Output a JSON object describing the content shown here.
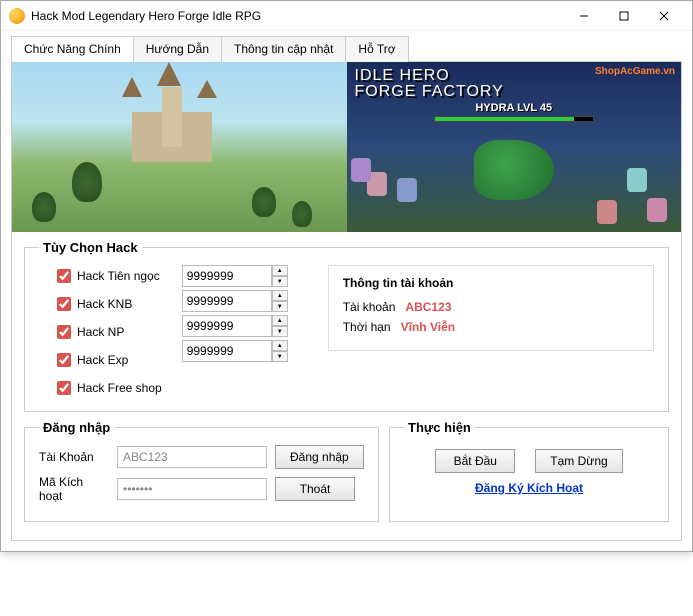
{
  "window": {
    "title": "Hack Mod Legendary Hero Forge Idle RPG"
  },
  "tabs": [
    {
      "label": "Chức Năng Chính"
    },
    {
      "label": "Hướng Dẫn"
    },
    {
      "label": "Thông tin cập nhật"
    },
    {
      "label": "Hỗ Trợ"
    }
  ],
  "banner": {
    "game_title_1": "IDLE HERO",
    "game_title_2": "FORGE FACTORY",
    "boss_label": "HYDRA LVL 45",
    "watermark": "ShopAcGame.vn"
  },
  "hack": {
    "legend": "Tùy Chọn Hack",
    "options": [
      {
        "label": "Hack Tiên ngọc",
        "value": "9999999"
      },
      {
        "label": "Hack KNB",
        "value": "9999999"
      },
      {
        "label": "Hack NP",
        "value": "9999999"
      },
      {
        "label": "Hack Exp",
        "value": "9999999"
      },
      {
        "label": "Hack Free shop"
      }
    ],
    "account_info": {
      "title": "Thông tin tài khoản",
      "acct_label": "Tài khoản",
      "acct_value": "ABC123",
      "expiry_label": "Thời hạn",
      "expiry_value": "Vĩnh Viễn"
    }
  },
  "login": {
    "legend": "Đăng nhập",
    "user_label": "Tài Khoản",
    "user_value": "ABC123",
    "key_label": "Mã Kích hoạt",
    "key_placeholder": "•••••••",
    "login_btn": "Đăng nhập",
    "exit_btn": "Thoát"
  },
  "exec": {
    "legend": "Thực hiện",
    "start_btn": "Bắt Đầu",
    "pause_btn": "Tạm Dừng",
    "register_link": "Đăng Ký Kích Hoạt"
  }
}
